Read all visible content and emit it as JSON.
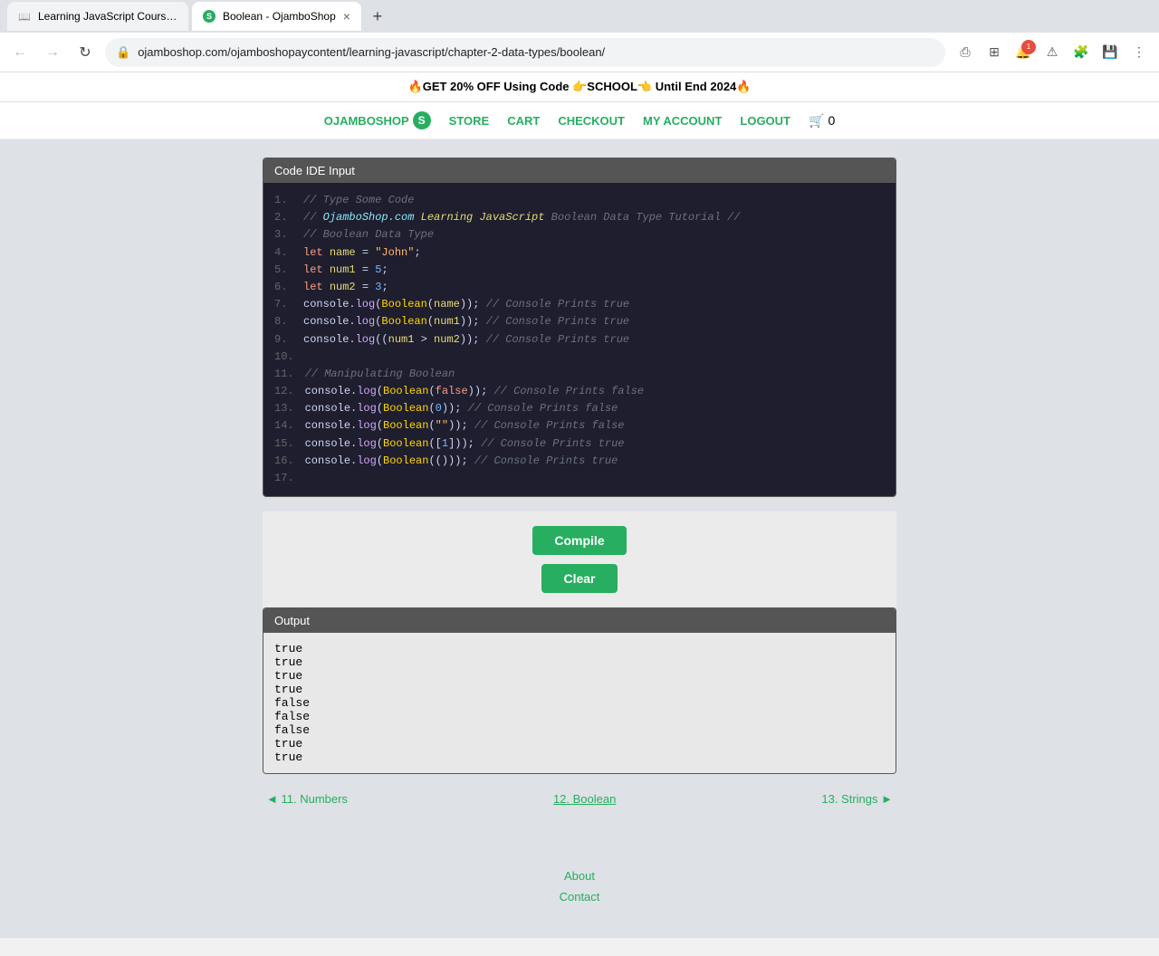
{
  "browser": {
    "tabs": [
      {
        "id": "tab1",
        "title": "Learning JavaScript Course - O...",
        "favicon": "📖",
        "active": false
      },
      {
        "id": "tab2",
        "title": "Boolean - OjamboShop",
        "favicon": "S",
        "active": true
      }
    ],
    "address": "ojamboshop.com/ojamboshopaycontent/learning-javascript/chapter-2-data-types/boolean/",
    "new_tab_label": "+"
  },
  "promo": {
    "text": "🔥GET 20% OFF Using Code 👉SCHOOL👈 Until End 2024🔥"
  },
  "site_nav": {
    "brand": "OJAMBOSHOP",
    "logo_letter": "S",
    "links": [
      "STORE",
      "CART",
      "CHECKOUT",
      "MY ACCOUNT",
      "LOGOUT"
    ],
    "cart_count": "0"
  },
  "code_ide": {
    "header": "Code IDE Input",
    "lines": [
      {
        "num": "1.",
        "content": "// Type Some Code"
      },
      {
        "num": "2.",
        "content": "// OjamboShop.com Learning JavaScript Boolean Data Type Tutorial //"
      },
      {
        "num": "3.",
        "content": "// Boolean Data Type"
      },
      {
        "num": "4.",
        "content": "let name = \"John\";"
      },
      {
        "num": "5.",
        "content": "let num1 = 5;"
      },
      {
        "num": "6.",
        "content": "let num2 = 3;"
      },
      {
        "num": "7.",
        "content": "console.log(Boolean(name)); // Console Prints true"
      },
      {
        "num": "8.",
        "content": "console.log(Boolean(num1)); // Console Prints true"
      },
      {
        "num": "9.",
        "content": "console.log((num1 > num2)); // Console Prints true"
      },
      {
        "num": "10.",
        "content": ""
      },
      {
        "num": "11.",
        "content": "// Manipulating Boolean"
      },
      {
        "num": "12.",
        "content": "console.log(Boolean(false)); // Console Prints false"
      },
      {
        "num": "13.",
        "content": "console.log(Boolean(0)); // Console Prints false"
      },
      {
        "num": "14.",
        "content": "console.log(Boolean(\"\")); // Console Prints false"
      },
      {
        "num": "15.",
        "content": "console.log(Boolean([1])); // Console Prints true"
      },
      {
        "num": "16.",
        "content": "console.log(Boolean(())); // Console Prints true"
      },
      {
        "num": "17.",
        "content": ""
      }
    ]
  },
  "buttons": {
    "compile_label": "Compile",
    "clear_label": "Clear"
  },
  "output": {
    "header": "Output",
    "lines": [
      "true",
      "true",
      "true",
      "true",
      "false",
      "false",
      "false",
      "true",
      "true"
    ]
  },
  "pagination": {
    "prev_label": "◄ 11. Numbers",
    "current_label": "12. Boolean",
    "next_label": "13. Strings ►"
  },
  "footer": {
    "links": [
      "About",
      "Contact"
    ]
  }
}
